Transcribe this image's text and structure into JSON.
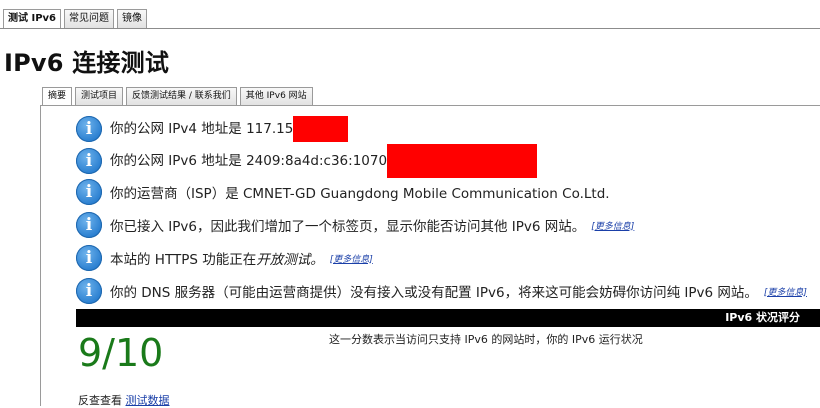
{
  "top_tabs": [
    "测试 IPv6",
    "常见问题",
    "镜像"
  ],
  "page_title": "IPv6 连接测试",
  "sub_tabs": [
    "摘要",
    "测试项目",
    "反馈测试结果 / 联系我们",
    "其他 IPv6 网站"
  ],
  "info": {
    "ipv4": "你的公网 IPv4 地址是 117.15",
    "ipv6": "你的公网 IPv6 地址是 2409:8a4d:c36:1070",
    "isp": "你的运营商（ISP）是 CMNET-GD Guangdong Mobile Communication Co.Ltd.",
    "tab_added": "你已接入 IPv6，因此我们增加了一个标签页，显示你能否访问其他 IPv6 网站。",
    "https_prefix": "本站的 HTTPS 功能正在",
    "https_italic": "开放测试。",
    "dns": "你的 DNS 服务器（可能由运营商提供）没有接入或没有配置 IPv6，将来这可能会妨碍你访问纯 IPv6 网站。",
    "more_link": "[更多信息]"
  },
  "score": {
    "bar_label": "IPv6 状况评分",
    "value": "9/10",
    "description": "这一分数表示当访问只支持 IPv6 的网站时，你的 IPv6 运行状况"
  },
  "footer": {
    "prefix": "反查查看",
    "link": "测试数据"
  },
  "colors": {
    "accent_link": "#1a3fa8",
    "score_green": "#1a7a1a",
    "info_blue": "#2a7fd0",
    "redaction": "#ff0000"
  }
}
